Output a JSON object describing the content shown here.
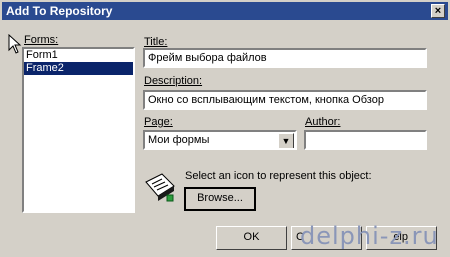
{
  "window": {
    "title": "Add To Repository",
    "close_glyph": "×"
  },
  "forms": {
    "label": "Forms:",
    "items": [
      "Form1",
      "Frame2"
    ],
    "selected_index": 1
  },
  "title_field": {
    "label": "Title:",
    "value": "Фрейм выбора файлов"
  },
  "description_field": {
    "label": "Description:",
    "value": "Окно со всплывающим текстом, кнопка Обзор"
  },
  "page_field": {
    "label": "Page:",
    "value": "Мои формы",
    "dropdown_glyph": "▼"
  },
  "author_field": {
    "label": "Author:",
    "value": ""
  },
  "icon_section": {
    "text": "Select an icon to represent this object:",
    "browse_label": "Browse..."
  },
  "buttons": {
    "ok_label": "OK",
    "cancel_partial_label": "C",
    "help_partial_label": "elp"
  },
  "watermark": "delphi-z.ru",
  "colors": {
    "titlebar": "#2a4a90",
    "selection": "#0a246a",
    "face": "#d4d0c8"
  }
}
